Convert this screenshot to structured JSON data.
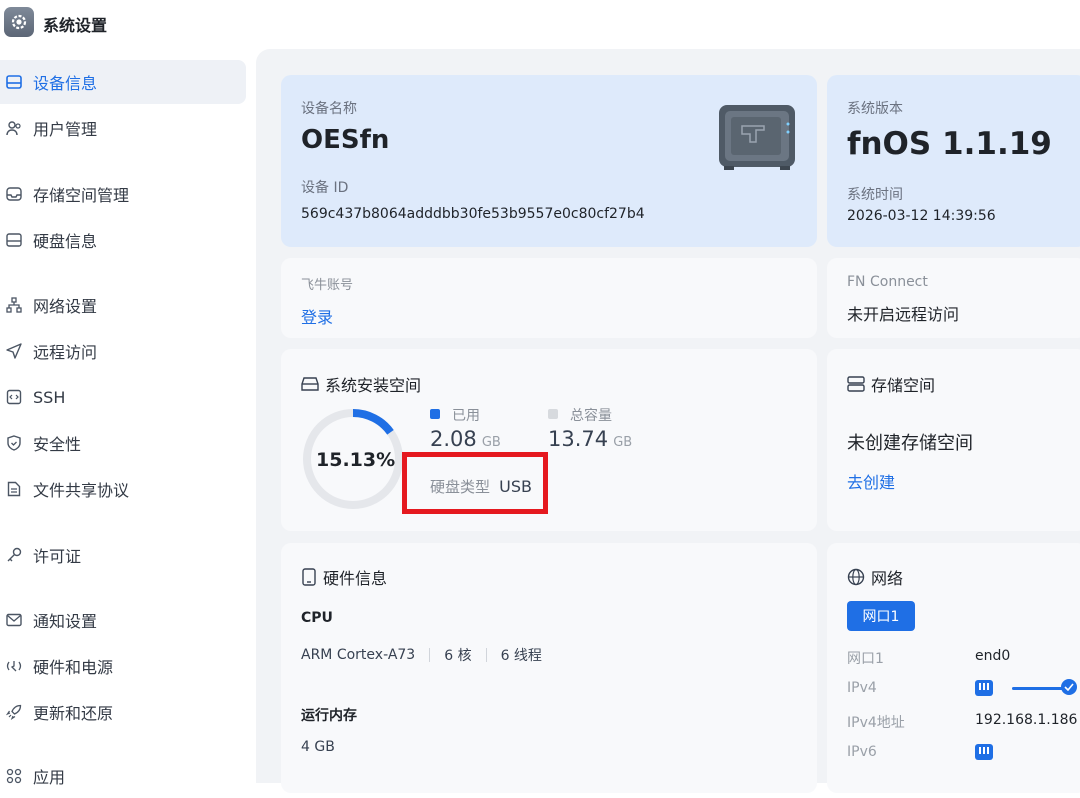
{
  "window": {
    "title": "系统设置",
    "icon": "gear-icon"
  },
  "sidebar": {
    "items": [
      {
        "label": "设备信息",
        "icon": "drive-icon",
        "active": true
      },
      {
        "label": "用户管理",
        "icon": "users-icon"
      },
      {
        "label": "存储空间管理",
        "icon": "storage-icon"
      },
      {
        "label": "硬盘信息",
        "icon": "disk-icon"
      },
      {
        "label": "网络设置",
        "icon": "network-icon"
      },
      {
        "label": "远程访问",
        "icon": "send-icon"
      },
      {
        "label": "SSH",
        "icon": "terminal-icon"
      },
      {
        "label": "安全性",
        "icon": "shield-icon"
      },
      {
        "label": "文件共享协议",
        "icon": "file-icon"
      },
      {
        "label": "许可证",
        "icon": "key-icon"
      },
      {
        "label": "通知设置",
        "icon": "mail-icon"
      },
      {
        "label": "硬件和电源",
        "icon": "power-icon"
      },
      {
        "label": "更新和还原",
        "icon": "rocket-icon"
      },
      {
        "label": "应用",
        "icon": "apps-icon"
      }
    ]
  },
  "device": {
    "name_label": "设备名称",
    "name": "OESfn",
    "id_label": "设备 ID",
    "id": "569c437b8064adddbb30fe53b9557e0c80cf27b4"
  },
  "system": {
    "version_label": "系统版本",
    "version": "fnOS 1.1.19",
    "time_label": "系统时间",
    "time": "2026-03-12 14:39:56"
  },
  "account": {
    "label": "飞牛账号",
    "login": "登录"
  },
  "fnconnect": {
    "label": "FN Connect",
    "status": "未开启远程访问"
  },
  "install_space": {
    "title": "系统安装空间",
    "percent": "15.13%",
    "percent_value": 15.13,
    "used_label": "已用",
    "used_value": "2.08",
    "used_unit": "GB",
    "total_label": "总容量",
    "total_value": "13.74",
    "total_unit": "GB",
    "disk_type_label": "硬盘类型",
    "disk_type": "USB",
    "used_color": "#1f6fe5",
    "track_color": "#e5e7eb",
    "highlight_color": "#e5191f"
  },
  "storage": {
    "title": "存储空间",
    "status": "未创建存储空间",
    "create": "去创建"
  },
  "hardware": {
    "title": "硬件信息",
    "cpu_label": "CPU",
    "cpu_model": "ARM Cortex-A73",
    "cpu_cores": "6 核",
    "cpu_threads": "6 线程",
    "mem_label": "运行内存",
    "mem_value": "4 GB"
  },
  "network": {
    "title": "网络",
    "tab": "网口1",
    "rows": [
      {
        "label": "网口1",
        "value": "end0"
      },
      {
        "label": "IPv4",
        "value": ""
      },
      {
        "label": "IPv4地址",
        "value": "192.168.1.186"
      },
      {
        "label": "IPv6",
        "value": ""
      }
    ],
    "ipv4_slider_level": 1.0
  }
}
